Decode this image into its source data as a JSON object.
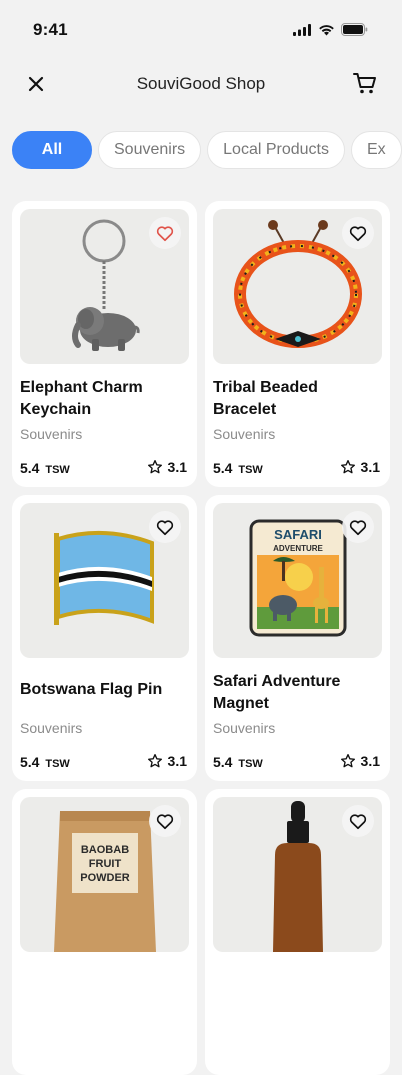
{
  "status": {
    "time": "9:41"
  },
  "header": {
    "title": "SouviGood Shop"
  },
  "categories": [
    "All",
    "Souvenirs",
    "Local Products",
    "Ex"
  ],
  "products": [
    {
      "name": "Elephant Charm Keychain",
      "category": "Souvenirs",
      "price": "5.4",
      "currency": "TSW",
      "rating": "3.1",
      "favorited": true,
      "image_icon": "elephant-keychain"
    },
    {
      "name": "Tribal Beaded Bracelet",
      "category": "Souvenirs",
      "price": "5.4",
      "currency": "TSW",
      "rating": "3.1",
      "favorited": false,
      "image_icon": "beaded-bracelet"
    },
    {
      "name": "Botswana Flag Pin",
      "category": "Souvenirs",
      "price": "5.4",
      "currency": "TSW",
      "rating": "3.1",
      "favorited": false,
      "image_icon": "flag-pin"
    },
    {
      "name": "Safari Adventure Magnet",
      "category": "Souvenirs",
      "price": "5.4",
      "currency": "TSW",
      "rating": "3.1",
      "favorited": false,
      "image_icon": "safari-magnet"
    },
    {
      "name": "",
      "category": "",
      "price": "",
      "currency": "",
      "rating": "",
      "favorited": false,
      "image_icon": "baobab-bag",
      "image_text": [
        "BAOBAB",
        "FRUIT",
        "POWDER"
      ]
    },
    {
      "name": "",
      "category": "",
      "price": "",
      "currency": "",
      "rating": "",
      "favorited": false,
      "image_icon": "dropper-bottle"
    }
  ],
  "magnet_text": [
    "SAFARI",
    "ADVENTURE"
  ],
  "colors": {
    "accent": "#3b82f6",
    "heart_active": "#e0534a"
  }
}
